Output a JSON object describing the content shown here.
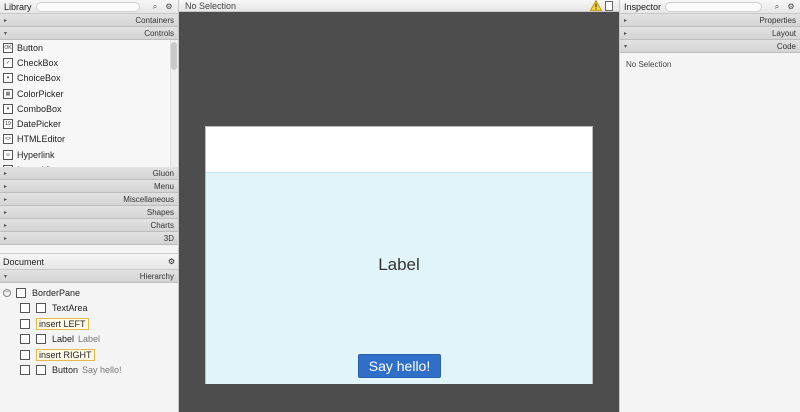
{
  "library": {
    "title": "Library",
    "sections_top": [
      {
        "label": "Containers",
        "expanded": false
      },
      {
        "label": "Controls",
        "expanded": true
      }
    ],
    "controls": [
      {
        "label": "Button",
        "icon": "button-icon",
        "glyph": "OK"
      },
      {
        "label": "CheckBox",
        "icon": "checkbox-icon",
        "glyph": "✓"
      },
      {
        "label": "ChoiceBox",
        "icon": "choicebox-icon",
        "glyph": "▾"
      },
      {
        "label": "ColorPicker",
        "icon": "colorpicker-icon",
        "glyph": "▦"
      },
      {
        "label": "ComboBox",
        "icon": "combobox-icon",
        "glyph": "▾"
      },
      {
        "label": "DatePicker",
        "icon": "datepicker-icon",
        "glyph": "19"
      },
      {
        "label": "HTMLEditor",
        "icon": "htmleditor-icon",
        "glyph": "<>"
      },
      {
        "label": "Hyperlink",
        "icon": "hyperlink-icon",
        "glyph": "∞"
      },
      {
        "label": "ImageView",
        "icon": "imageview-icon",
        "glyph": "▣"
      }
    ],
    "sections_bottom": [
      "Gluon",
      "Menu",
      "Miscellaneous",
      "Shapes",
      "Charts",
      "3D"
    ]
  },
  "document": {
    "title": "Document",
    "hierarchy_label": "Hierarchy",
    "tree": [
      {
        "name": "BorderPane",
        "sub": "",
        "insert": false,
        "indent": 0
      },
      {
        "name": "TextArea",
        "sub": "",
        "insert": false,
        "indent": 1
      },
      {
        "name": "insert LEFT",
        "sub": "",
        "insert": true,
        "indent": 1
      },
      {
        "name": "Label",
        "sub": "Label",
        "insert": false,
        "indent": 1
      },
      {
        "name": "insert RIGHT",
        "sub": "",
        "insert": true,
        "indent": 1
      },
      {
        "name": "Button",
        "sub": "Say hello!",
        "insert": false,
        "indent": 1
      }
    ]
  },
  "center": {
    "status": "No Selection",
    "canvas_label": "Label",
    "button_label": "Say hello!"
  },
  "inspector": {
    "title": "Inspector",
    "sections": [
      {
        "label": "Properties",
        "expanded": false
      },
      {
        "label": "Layout",
        "expanded": false
      },
      {
        "label": "Code",
        "expanded": true
      }
    ],
    "empty_text": "No Selection"
  },
  "colors": {
    "accent": "#2f6fc7",
    "canvas_bg": "#e0f4fa",
    "workspace": "#4d4d4d",
    "insert_border": "#e6b94a"
  }
}
